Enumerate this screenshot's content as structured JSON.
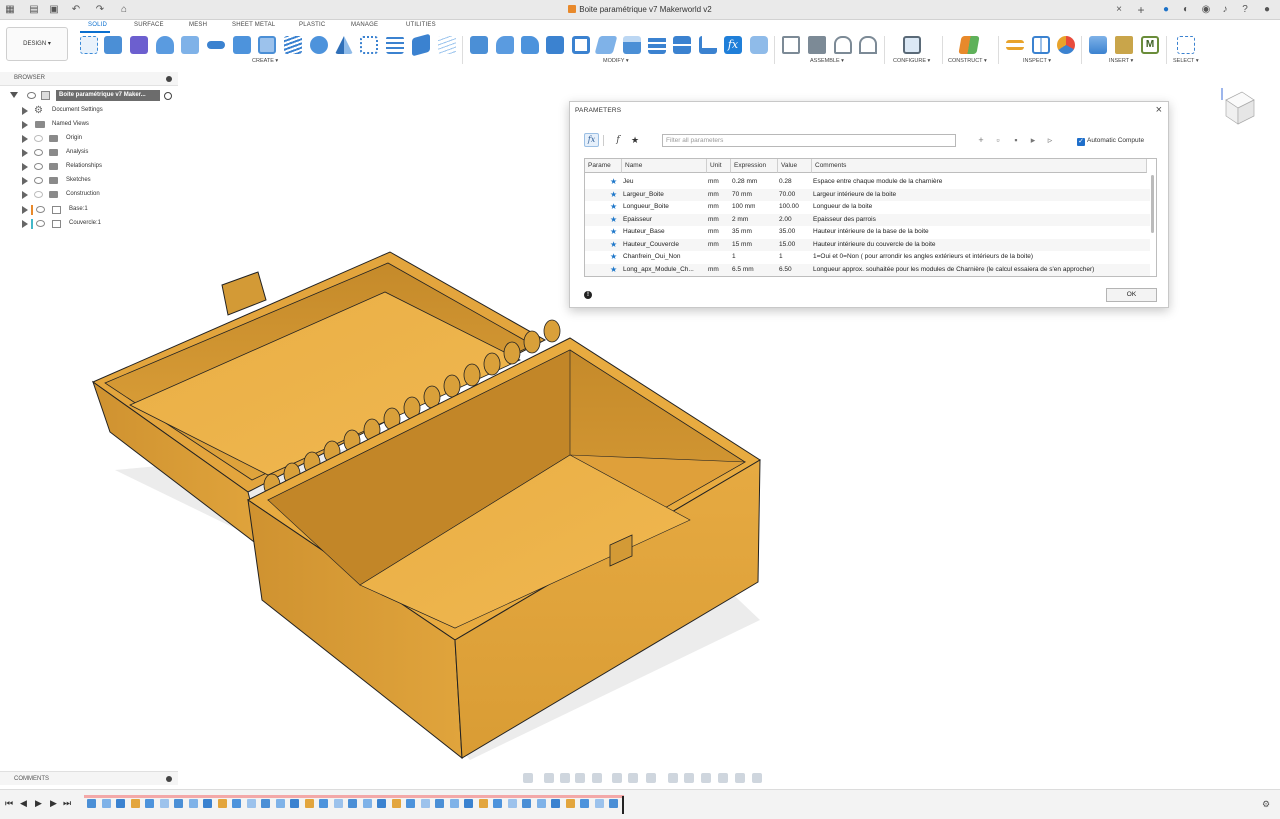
{
  "app": {
    "window_title": "Boite paramétrique v7 Makerworld v2"
  },
  "tabs": [
    "SOLID",
    "SURFACE",
    "MESH",
    "SHEET METAL",
    "PLASTIC",
    "MANAGE",
    "UTILITIES"
  ],
  "active_tab": "SOLID",
  "toolbar": {
    "design_label": "DESIGN ▾",
    "groups": [
      "CREATE ▾",
      "MODIFY ▾",
      "ASSEMBLE ▾",
      "CONFIGURE ▾",
      "CONSTRUCT ▾",
      "INSPECT ▾",
      "INSERT ▾",
      "SELECT ▾"
    ]
  },
  "browser": {
    "title": "BROWSER",
    "root_label": "Boite paramétrique v7 Maker...",
    "items": [
      "Document Settings",
      "Named Views",
      "Origin",
      "Analysis",
      "Relationships",
      "Sketches",
      "Construction",
      "Base:1",
      "Couvercle:1"
    ]
  },
  "dialog": {
    "title": "PARAMETERS",
    "close_glyph": "×",
    "filter_placeholder": "Filter all parameters",
    "auto_compute_label": "Automatic Compute",
    "ok_label": "OK",
    "columns": [
      "Parame",
      "Name",
      "Unit",
      "Expression",
      "Value",
      "Comments"
    ],
    "rows": [
      {
        "name": "Jeu",
        "unit": "mm",
        "expression": "0.28 mm",
        "value": "0.28",
        "comment": "Espace entre chaque module de la charnière"
      },
      {
        "name": "Largeur_Boite",
        "unit": "mm",
        "expression": "70 mm",
        "value": "70.00",
        "comment": "Largeur intérieure de la boite"
      },
      {
        "name": "Longueur_Boite",
        "unit": "mm",
        "expression": "100 mm",
        "value": "100.00",
        "comment": "Longueur de la boite"
      },
      {
        "name": "Epaisseur",
        "unit": "mm",
        "expression": "2 mm",
        "value": "2.00",
        "comment": "Epaisseur des parrois"
      },
      {
        "name": "Hauteur_Base",
        "unit": "mm",
        "expression": "35 mm",
        "value": "35.00",
        "comment": "Hauteur intérieure de la base de la boite"
      },
      {
        "name": "Hauteur_Couvercle",
        "unit": "mm",
        "expression": "15 mm",
        "value": "15.00",
        "comment": "Hauteur intérieure du couvercle de la boite"
      },
      {
        "name": "Chanfrein_Oui_Non",
        "unit": "",
        "expression": "1",
        "value": "1",
        "comment": "1=Oui et 0=Non ( pour arrondir les angles extérieurs et intérieurs de la boite)"
      },
      {
        "name": "Long_apx_Module_Ch...",
        "unit": "mm",
        "expression": "6.5 mm",
        "value": "6.50",
        "comment": "Longueur approx. souhaitée pour les modules de Charnière (le calcul essaiera de s'en approcher)"
      }
    ]
  },
  "comments_panel": {
    "title": "COMMENTS"
  },
  "colors": {
    "accent": "#0a6fcf",
    "model": "#e2a63b",
    "model_dark": "#b87f22"
  }
}
